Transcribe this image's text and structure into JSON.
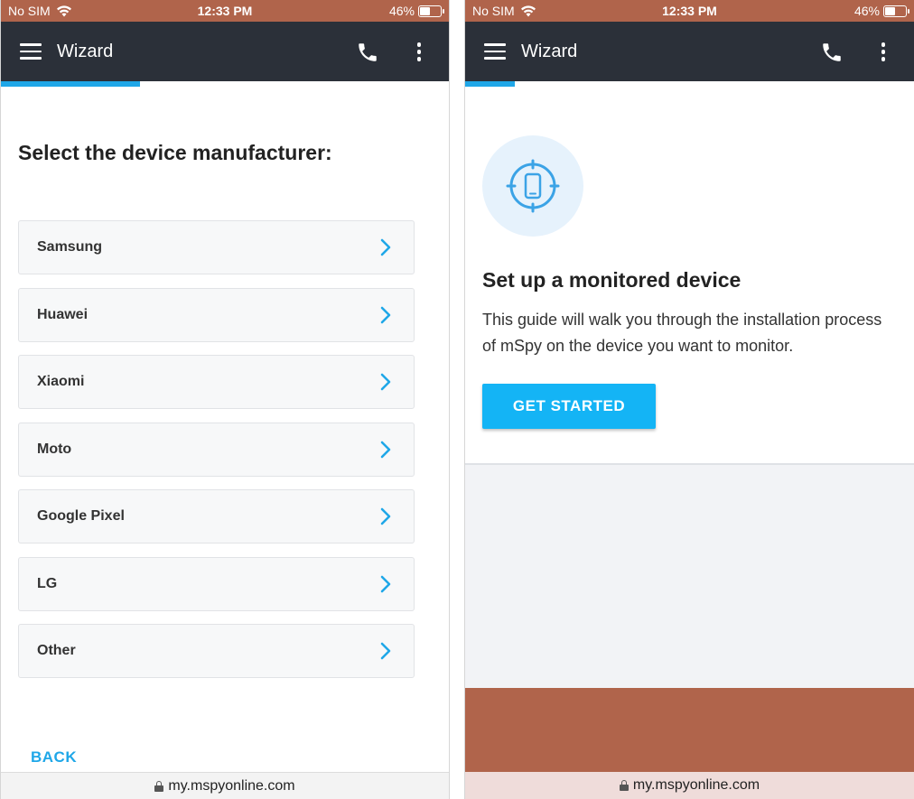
{
  "status_bar": {
    "carrier": "No SIM",
    "time": "12:33 PM",
    "battery": "46%",
    "battery_level": 0.46
  },
  "left": {
    "appbar": {
      "title": "Wizard"
    },
    "progress": 0.31,
    "heading": "Select the device manufacturer:",
    "manufacturers": [
      "Samsung",
      "Huawei",
      "Xiaomi",
      "Moto",
      "Google Pixel",
      "LG",
      "Other"
    ],
    "back_label": "BACK",
    "url": "my.mspyonline.com"
  },
  "right": {
    "appbar": {
      "title": "Wizard"
    },
    "progress": 0.11,
    "setup_title": "Set up a monitored device",
    "setup_desc": "This guide will walk you through the installation process of mSpy on the device you want to monitor.",
    "start_label": "GET STARTED",
    "url": "my.mspyonline.com"
  },
  "colors": {
    "accent": "#1fa7e8",
    "appbar": "#2b3039",
    "status_bar": "#b0644b"
  },
  "icons": [
    "menu-icon",
    "phone-icon",
    "more-vert-icon",
    "chevron-right-icon",
    "lock-icon",
    "target-phone-icon",
    "wifi-icon"
  ]
}
